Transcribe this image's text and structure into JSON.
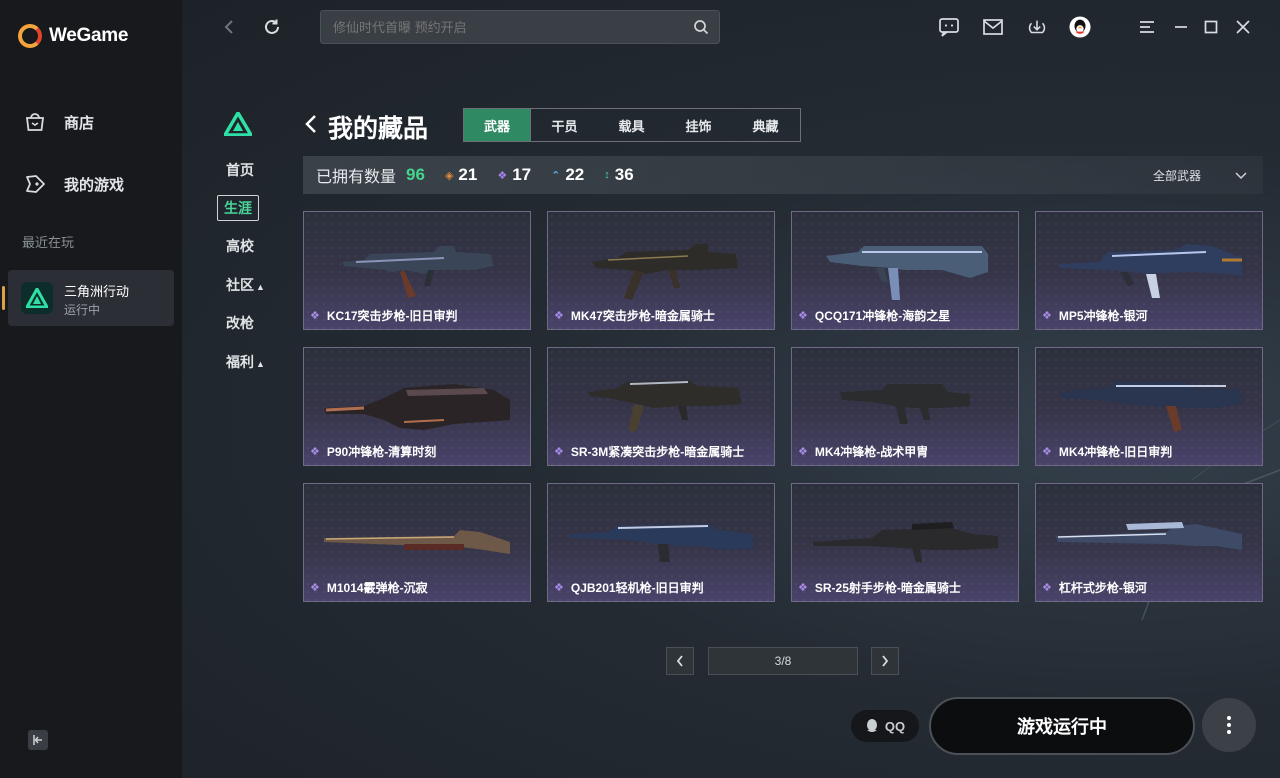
{
  "app": {
    "brand": "WeGame"
  },
  "sidebar": {
    "items": [
      {
        "label": "商店",
        "icon": "store-bag-icon"
      },
      {
        "label": "我的游戏",
        "icon": "gamepad-icon"
      }
    ],
    "recent_title": "最近在玩",
    "recent_game": {
      "name": "三角洲行动",
      "status": "运行中"
    }
  },
  "topbar": {
    "search_placeholder": "修仙时代首曝 预约开启",
    "icons": [
      "chat-icon",
      "mail-icon",
      "download-icon",
      "avatar",
      "menu-icon",
      "minimize-icon",
      "maximize-icon",
      "close-icon"
    ]
  },
  "game_nav": {
    "items": [
      "首页",
      "生涯",
      "高校",
      "社区",
      "改枪",
      "福利"
    ],
    "active": "生涯"
  },
  "page": {
    "title": "我的藏品",
    "tabs": [
      "武器",
      "干员",
      "载具",
      "挂饰",
      "典藏"
    ],
    "active_tab": "武器"
  },
  "stats": {
    "owned_label": "已拥有数量",
    "owned_count": "96",
    "chips": [
      {
        "value": "21",
        "color": "#e58a3a"
      },
      {
        "value": "17",
        "color": "#a882ee"
      },
      {
        "value": "22",
        "color": "#5ab0f0"
      },
      {
        "value": "36",
        "color": "#3fd49a"
      }
    ],
    "filter": "全部武器"
  },
  "items": [
    "KC17突击步枪-旧日审判",
    "MK47突击步枪-暗金属骑士",
    "QCQ171冲锋枪-海韵之星",
    "MP5冲锋枪-银河",
    "P90冲锋枪-清算时刻",
    "SR-3M紧凑突击步枪-暗金属骑士",
    "MK4冲锋枪-战术甲胄",
    "MK4冲锋枪-旧日审判",
    "M1014霰弹枪-沉寂",
    "QJB201轻机枪-旧日审判",
    "SR-25射手步枪-暗金属骑士",
    "杠杆式步枪-银河"
  ],
  "pager": {
    "text": "3/8"
  },
  "bottom": {
    "qq": "QQ",
    "run": "游戏运行中"
  }
}
